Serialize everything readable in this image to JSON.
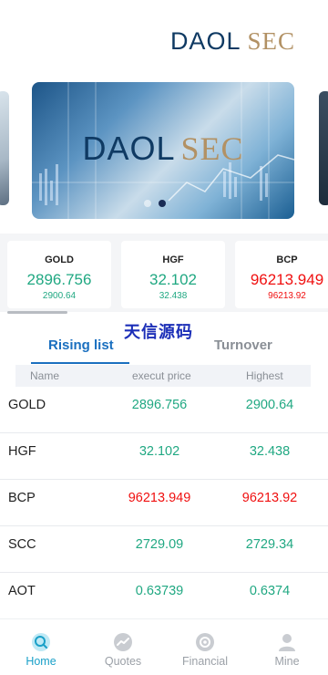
{
  "header": {
    "logo_part1": "DAOL",
    "logo_part2": "SEC"
  },
  "banner": {
    "title_part1": "DAOL",
    "title_part2": "SEC",
    "active_slide": 2,
    "slide_count": 2
  },
  "tickers": [
    {
      "symbol": "GOLD",
      "price": "2896.756",
      "sub": "2900.64",
      "trend": "up"
    },
    {
      "symbol": "HGF",
      "price": "32.102",
      "sub": "32.438",
      "trend": "up"
    },
    {
      "symbol": "BCP",
      "price": "96213.949",
      "sub": "96213.92",
      "trend": "down"
    }
  ],
  "watermark": "天信源码",
  "tabs": {
    "rising": "Rising list",
    "turnover": "Turnover",
    "active": "rising"
  },
  "table": {
    "headers": {
      "name": "Name",
      "price": "execut price",
      "high": "Highest"
    },
    "rows": [
      {
        "name": "GOLD",
        "price": "2896.756",
        "high": "2900.64",
        "color": "green"
      },
      {
        "name": "HGF",
        "price": "32.102",
        "high": "32.438",
        "color": "green"
      },
      {
        "name": "BCP",
        "price": "96213.949",
        "high": "96213.92",
        "color": "red"
      },
      {
        "name": "SCC",
        "price": "2729.09",
        "high": "2729.34",
        "color": "green"
      },
      {
        "name": "AOT",
        "price": "0.63739",
        "high": "0.6374",
        "color": "green"
      }
    ]
  },
  "nav": {
    "home": "Home",
    "quotes": "Quotes",
    "financial": "Financial",
    "mine": "Mine",
    "active": "home"
  },
  "colors": {
    "up": "#20a882",
    "down": "#f01010",
    "accent": "#1a6fbf",
    "nav_active": "#1aa0c8"
  }
}
